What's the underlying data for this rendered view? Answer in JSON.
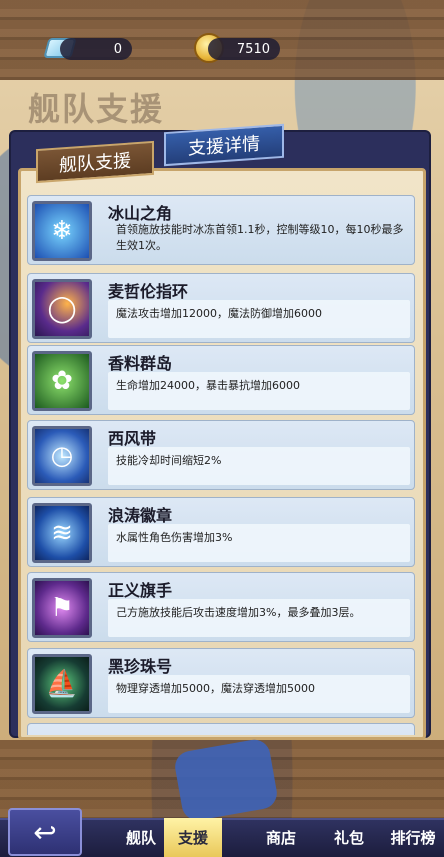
{
  "resources": {
    "gem_icon": "crystal-icon",
    "gems": "0",
    "gold_icon": "gold-coin-icon",
    "gold": "7510"
  },
  "page_title": "舰队支援",
  "tabs": [
    {
      "label": "舰队支援",
      "active": false
    },
    {
      "label": "支援详情",
      "active": true
    }
  ],
  "items": [
    {
      "name": "冰山之角",
      "desc": "首领施放技能时冰冻首领1.1秒，控制等级10，每10秒最多生效1次。",
      "icon": "ice-witch-icon"
    },
    {
      "name": "麦哲伦指环",
      "desc": "魔法攻击增加12000，魔法防御增加6000",
      "icon": "ring-icon"
    },
    {
      "name": "香料群岛",
      "desc": "生命增加24000，暴击暴抗增加6000",
      "icon": "island-icon"
    },
    {
      "name": "西风带",
      "desc": "技能冷却时间缩短2%",
      "icon": "clock-icon"
    },
    {
      "name": "浪涛徽章",
      "desc": "水属性角色伤害增加3%",
      "icon": "wave-icon"
    },
    {
      "name": "正义旗手",
      "desc": "己方施放技能后攻击速度增加3%，最多叠加3层。",
      "icon": "flag-bearer-icon"
    },
    {
      "name": "黑珍珠号",
      "desc": "物理穿透增加5000，魔法穿透增加5000",
      "icon": "ship-icon"
    }
  ],
  "nav": {
    "back_icon": "back-arrow-icon",
    "items": [
      {
        "label": "舰队",
        "active": false
      },
      {
        "label": "支援",
        "active": true
      },
      {
        "label": "商店",
        "active": false
      },
      {
        "label": "礼包",
        "active": false
      },
      {
        "label": "排行榜",
        "active": false
      }
    ]
  },
  "colors": {
    "panel": "#2c2f5c",
    "row": "#dde8f5",
    "active_nav": "#e9c85a"
  }
}
